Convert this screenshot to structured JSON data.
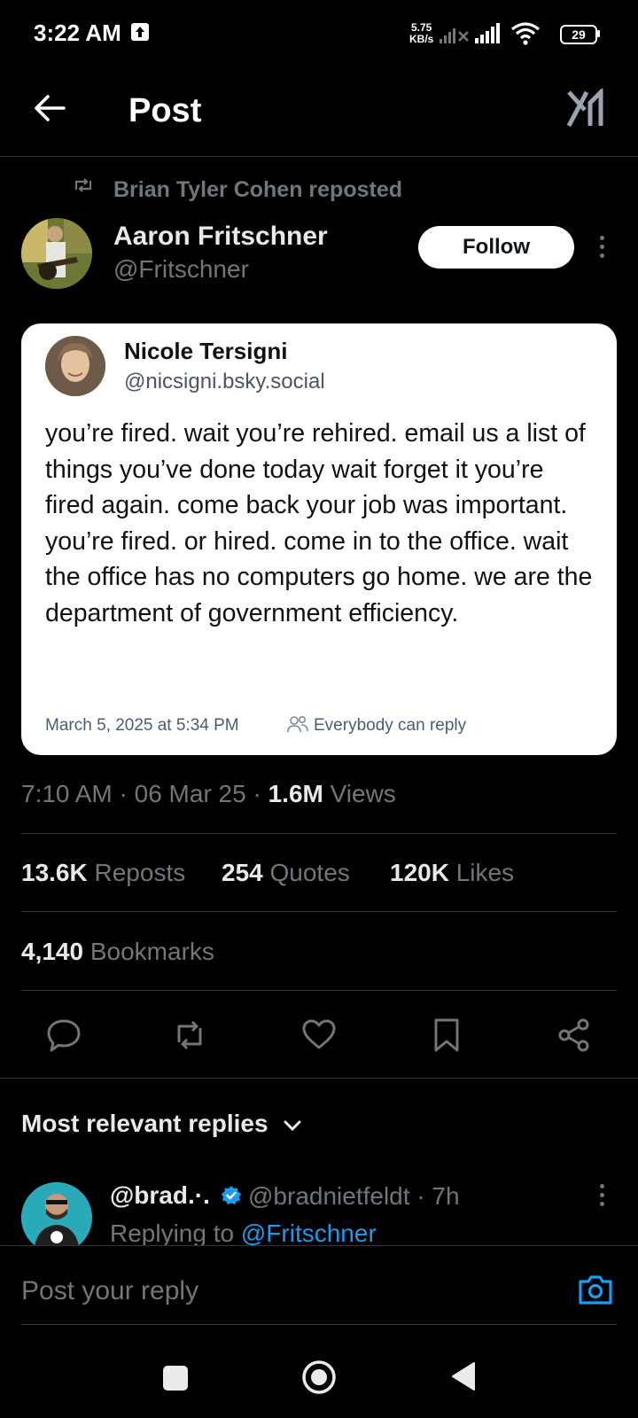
{
  "status_bar": {
    "time": "3:22 AM",
    "net_speed_value": "5.75",
    "net_speed_unit": "KB/s",
    "battery": "29"
  },
  "header": {
    "title": "Post"
  },
  "post": {
    "repost_label": "Brian Tyler Cohen reposted",
    "author_name": "Aaron Fritschner",
    "author_handle": "@Fritschner",
    "follow_label": "Follow",
    "card": {
      "name": "Nicole Tersigni",
      "handle": "@nicsigni.bsky.social",
      "body": "you’re fired. wait you’re rehired. email us a list of things you’ve done today wait forget it you’re fired again. come back your job was important. you’re fired. or hired. come in to the office. wait the office has no computers go home. we are the department of government efficiency.",
      "timestamp": "March 5, 2025 at 5:34 PM",
      "reply_setting": "Everybody can reply"
    },
    "time": "7:10 AM",
    "date": "06 Mar 25",
    "views_count": "1.6M",
    "views_label": "Views",
    "stats": {
      "reposts_count": "13.6K",
      "reposts_label": "Reposts",
      "quotes_count": "254",
      "quotes_label": "Quotes",
      "likes_count": "120K",
      "likes_label": "Likes",
      "bookmarks_count": "4,140",
      "bookmarks_label": "Bookmarks"
    }
  },
  "replies": {
    "heading": "Most relevant replies",
    "first": {
      "name": "@brad.·.",
      "handle": "@bradnietfeldt · 7h",
      "replying_prefix": "Replying to",
      "replying_to": "@Fritschner"
    }
  },
  "composer": {
    "placeholder": "Post your reply"
  },
  "colors": {
    "background": "#000000",
    "text_primary": "#e7e9ea",
    "text_secondary": "#71767b",
    "accent": "#1d9bf0",
    "divider": "#2f3336"
  }
}
